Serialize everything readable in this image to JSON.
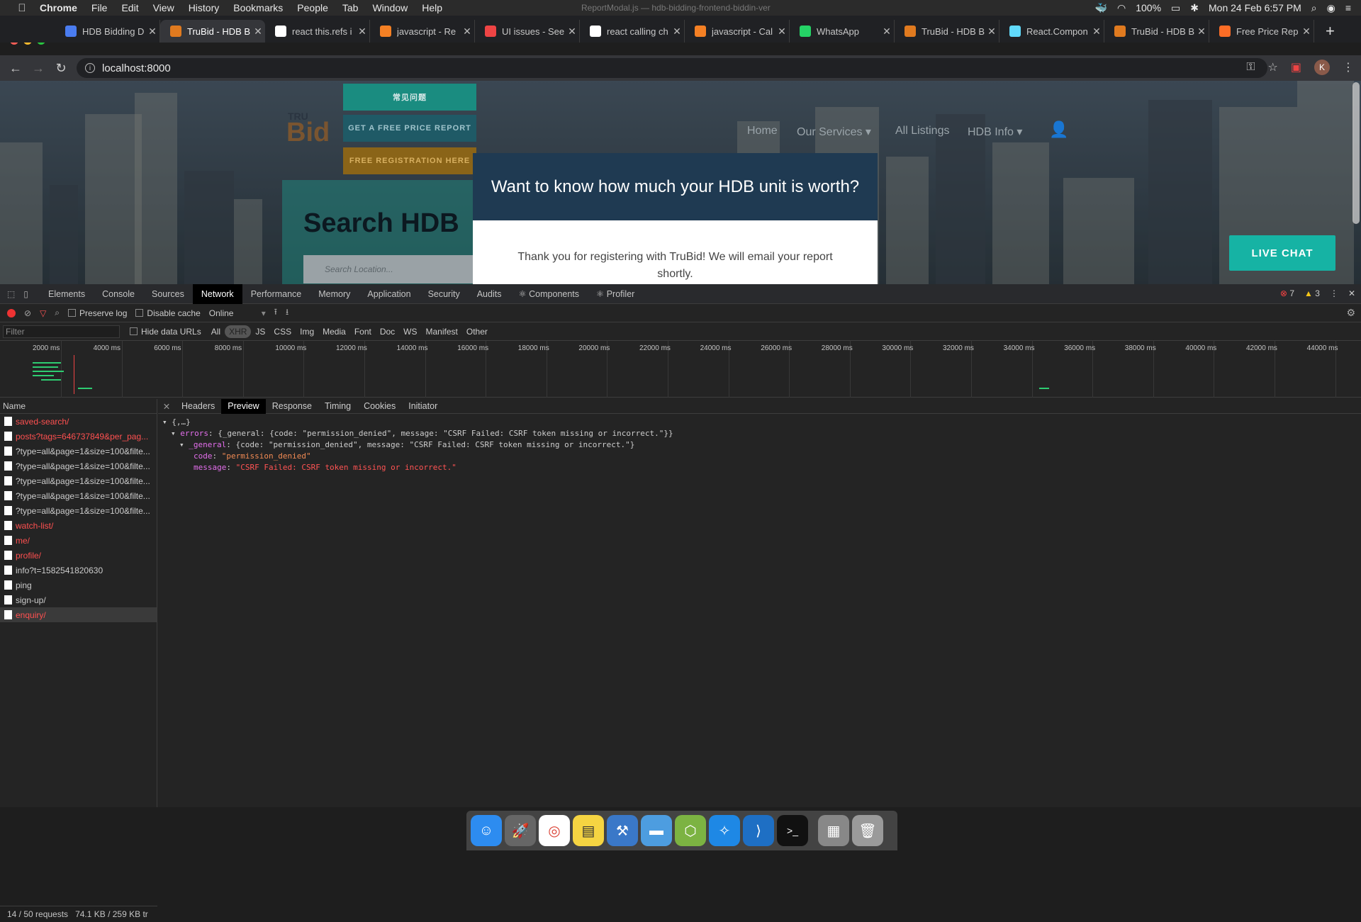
{
  "menubar": {
    "app": "Chrome",
    "items": [
      "File",
      "Edit",
      "View",
      "History",
      "Bookmarks",
      "People",
      "Tab",
      "Window",
      "Help"
    ],
    "window_title": "ReportModal.js — hdb-bidding-frontend-biddin-ver",
    "battery": "100%",
    "datetime": "Mon 24 Feb  6:57 PM"
  },
  "tabs": [
    {
      "label": "HDB Bidding D",
      "icon": "docs-icon",
      "color": "#4a7cf0"
    },
    {
      "label": "TruBid - HDB B",
      "icon": "trubid-icon",
      "color": "#e07a1f",
      "active": true
    },
    {
      "label": "react this.refs i",
      "icon": "google-icon",
      "color": "#ffffff"
    },
    {
      "label": "javascript - Re",
      "icon": "stackoverflow-icon",
      "color": "#f48024"
    },
    {
      "label": "UI issues - See",
      "icon": "jira-icon",
      "color": "#e44"
    },
    {
      "label": "react calling ch",
      "icon": "google-icon",
      "color": "#ffffff"
    },
    {
      "label": "javascript - Cal",
      "icon": "stackoverflow-icon",
      "color": "#f48024"
    },
    {
      "label": "WhatsApp",
      "icon": "whatsapp-icon",
      "color": "#25d366"
    },
    {
      "label": "TruBid - HDB B",
      "icon": "trubid-icon",
      "color": "#e07a1f"
    },
    {
      "label": "React.Compon",
      "icon": "react-icon",
      "color": "#61dafb"
    },
    {
      "label": "TruBid - HDB B",
      "icon": "trubid-icon",
      "color": "#e07a1f"
    },
    {
      "label": "Free Price Rep",
      "icon": "gitlab-icon",
      "color": "#fc6d26"
    }
  ],
  "address": {
    "url": "localhost:8000"
  },
  "page": {
    "btn_faq": "常见问题",
    "btn_report": "GET A FREE PRICE REPORT",
    "btn_register": "FREE REGISTRATION HERE",
    "logo_small": "TRU",
    "logo_big": "Bid",
    "nav": [
      "Home",
      "Our Services ▾",
      "All Listings",
      "HDB Info ▾"
    ],
    "search_title": "Search HDB",
    "search_placeholder": "Search Location...",
    "modal_title": "Want to know how much your HDB unit is worth?",
    "modal_body": "Thank you for registering with TruBid! We will email your report shortly.",
    "live_chat": "LIVE CHAT"
  },
  "devtools": {
    "tabs": [
      "Elements",
      "Console",
      "Sources",
      "Network",
      "Performance",
      "Memory",
      "Application",
      "Security",
      "Audits",
      "⚛ Components",
      "⚛ Profiler"
    ],
    "active_tab": "Network",
    "errors": "7",
    "warnings": "3",
    "toolbar": {
      "preserve_log": "Preserve log",
      "disable_cache": "Disable cache",
      "throttle": "Online"
    },
    "filter_placeholder": "Filter",
    "hide_data_urls": "Hide data URLs",
    "types": [
      "All",
      "XHR",
      "JS",
      "CSS",
      "Img",
      "Media",
      "Font",
      "Doc",
      "WS",
      "Manifest",
      "Other"
    ],
    "active_type": "XHR",
    "timeline_ticks": [
      "2000 ms",
      "4000 ms",
      "6000 ms",
      "8000 ms",
      "10000 ms",
      "12000 ms",
      "14000 ms",
      "16000 ms",
      "18000 ms",
      "20000 ms",
      "22000 ms",
      "24000 ms",
      "26000 ms",
      "28000 ms",
      "30000 ms",
      "32000 ms",
      "34000 ms",
      "36000 ms",
      "38000 ms",
      "40000 ms",
      "42000 ms",
      "44000 ms"
    ],
    "name_header": "Name",
    "requests": [
      {
        "name": "saved-search/",
        "error": true
      },
      {
        "name": "posts?tags=646737849&per_pag...",
        "error": true
      },
      {
        "name": "?type=all&page=1&size=100&filte...",
        "error": false
      },
      {
        "name": "?type=all&page=1&size=100&filte...",
        "error": false
      },
      {
        "name": "?type=all&page=1&size=100&filte...",
        "error": false
      },
      {
        "name": "?type=all&page=1&size=100&filte...",
        "error": false
      },
      {
        "name": "?type=all&page=1&size=100&filte...",
        "error": false
      },
      {
        "name": "watch-list/",
        "error": true
      },
      {
        "name": "me/",
        "error": true
      },
      {
        "name": "profile/",
        "error": true
      },
      {
        "name": "info?t=1582541820630",
        "error": false
      },
      {
        "name": "ping",
        "error": false
      },
      {
        "name": "sign-up/",
        "error": false
      },
      {
        "name": "enquiry/",
        "error": true,
        "selected": true
      }
    ],
    "detail_tabs": [
      "Headers",
      "Preview",
      "Response",
      "Timing",
      "Cookies",
      "Initiator"
    ],
    "active_detail": "Preview",
    "preview": {
      "root": "{,…}",
      "errors_key": "errors",
      "errors_summary": "{_general: {code: \"permission_denied\", message: \"CSRF Failed: CSRF token missing or incorrect.\"}}",
      "general_key": "_general",
      "general_summary": "{code: \"permission_denied\", message: \"CSRF Failed: CSRF token missing or incorrect.\"}",
      "code_key": "code",
      "code_val": "\"permission_denied\"",
      "message_key": "message",
      "message_val": "\"CSRF Failed: CSRF token missing or incorrect.\""
    },
    "status": {
      "requests": "14 / 50 requests",
      "size": "74.1 KB / 259 KB tr"
    }
  }
}
